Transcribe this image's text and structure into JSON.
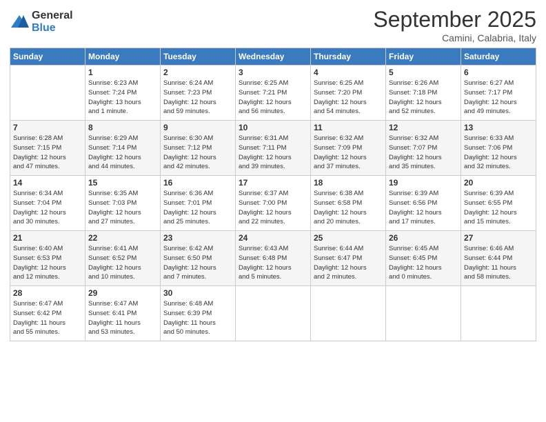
{
  "logo": {
    "general": "General",
    "blue": "Blue"
  },
  "title": "September 2025",
  "subtitle": "Camini, Calabria, Italy",
  "days_of_week": [
    "Sunday",
    "Monday",
    "Tuesday",
    "Wednesday",
    "Thursday",
    "Friday",
    "Saturday"
  ],
  "weeks": [
    [
      {
        "day": "",
        "info": ""
      },
      {
        "day": "1",
        "info": "Sunrise: 6:23 AM\nSunset: 7:24 PM\nDaylight: 13 hours\nand 1 minute."
      },
      {
        "day": "2",
        "info": "Sunrise: 6:24 AM\nSunset: 7:23 PM\nDaylight: 12 hours\nand 59 minutes."
      },
      {
        "day": "3",
        "info": "Sunrise: 6:25 AM\nSunset: 7:21 PM\nDaylight: 12 hours\nand 56 minutes."
      },
      {
        "day": "4",
        "info": "Sunrise: 6:25 AM\nSunset: 7:20 PM\nDaylight: 12 hours\nand 54 minutes."
      },
      {
        "day": "5",
        "info": "Sunrise: 6:26 AM\nSunset: 7:18 PM\nDaylight: 12 hours\nand 52 minutes."
      },
      {
        "day": "6",
        "info": "Sunrise: 6:27 AM\nSunset: 7:17 PM\nDaylight: 12 hours\nand 49 minutes."
      }
    ],
    [
      {
        "day": "7",
        "info": "Sunrise: 6:28 AM\nSunset: 7:15 PM\nDaylight: 12 hours\nand 47 minutes."
      },
      {
        "day": "8",
        "info": "Sunrise: 6:29 AM\nSunset: 7:14 PM\nDaylight: 12 hours\nand 44 minutes."
      },
      {
        "day": "9",
        "info": "Sunrise: 6:30 AM\nSunset: 7:12 PM\nDaylight: 12 hours\nand 42 minutes."
      },
      {
        "day": "10",
        "info": "Sunrise: 6:31 AM\nSunset: 7:11 PM\nDaylight: 12 hours\nand 39 minutes."
      },
      {
        "day": "11",
        "info": "Sunrise: 6:32 AM\nSunset: 7:09 PM\nDaylight: 12 hours\nand 37 minutes."
      },
      {
        "day": "12",
        "info": "Sunrise: 6:32 AM\nSunset: 7:07 PM\nDaylight: 12 hours\nand 35 minutes."
      },
      {
        "day": "13",
        "info": "Sunrise: 6:33 AM\nSunset: 7:06 PM\nDaylight: 12 hours\nand 32 minutes."
      }
    ],
    [
      {
        "day": "14",
        "info": "Sunrise: 6:34 AM\nSunset: 7:04 PM\nDaylight: 12 hours\nand 30 minutes."
      },
      {
        "day": "15",
        "info": "Sunrise: 6:35 AM\nSunset: 7:03 PM\nDaylight: 12 hours\nand 27 minutes."
      },
      {
        "day": "16",
        "info": "Sunrise: 6:36 AM\nSunset: 7:01 PM\nDaylight: 12 hours\nand 25 minutes."
      },
      {
        "day": "17",
        "info": "Sunrise: 6:37 AM\nSunset: 7:00 PM\nDaylight: 12 hours\nand 22 minutes."
      },
      {
        "day": "18",
        "info": "Sunrise: 6:38 AM\nSunset: 6:58 PM\nDaylight: 12 hours\nand 20 minutes."
      },
      {
        "day": "19",
        "info": "Sunrise: 6:39 AM\nSunset: 6:56 PM\nDaylight: 12 hours\nand 17 minutes."
      },
      {
        "day": "20",
        "info": "Sunrise: 6:39 AM\nSunset: 6:55 PM\nDaylight: 12 hours\nand 15 minutes."
      }
    ],
    [
      {
        "day": "21",
        "info": "Sunrise: 6:40 AM\nSunset: 6:53 PM\nDaylight: 12 hours\nand 12 minutes."
      },
      {
        "day": "22",
        "info": "Sunrise: 6:41 AM\nSunset: 6:52 PM\nDaylight: 12 hours\nand 10 minutes."
      },
      {
        "day": "23",
        "info": "Sunrise: 6:42 AM\nSunset: 6:50 PM\nDaylight: 12 hours\nand 7 minutes."
      },
      {
        "day": "24",
        "info": "Sunrise: 6:43 AM\nSunset: 6:48 PM\nDaylight: 12 hours\nand 5 minutes."
      },
      {
        "day": "25",
        "info": "Sunrise: 6:44 AM\nSunset: 6:47 PM\nDaylight: 12 hours\nand 2 minutes."
      },
      {
        "day": "26",
        "info": "Sunrise: 6:45 AM\nSunset: 6:45 PM\nDaylight: 12 hours\nand 0 minutes."
      },
      {
        "day": "27",
        "info": "Sunrise: 6:46 AM\nSunset: 6:44 PM\nDaylight: 11 hours\nand 58 minutes."
      }
    ],
    [
      {
        "day": "28",
        "info": "Sunrise: 6:47 AM\nSunset: 6:42 PM\nDaylight: 11 hours\nand 55 minutes."
      },
      {
        "day": "29",
        "info": "Sunrise: 6:47 AM\nSunset: 6:41 PM\nDaylight: 11 hours\nand 53 minutes."
      },
      {
        "day": "30",
        "info": "Sunrise: 6:48 AM\nSunset: 6:39 PM\nDaylight: 11 hours\nand 50 minutes."
      },
      {
        "day": "",
        "info": ""
      },
      {
        "day": "",
        "info": ""
      },
      {
        "day": "",
        "info": ""
      },
      {
        "day": "",
        "info": ""
      }
    ]
  ]
}
